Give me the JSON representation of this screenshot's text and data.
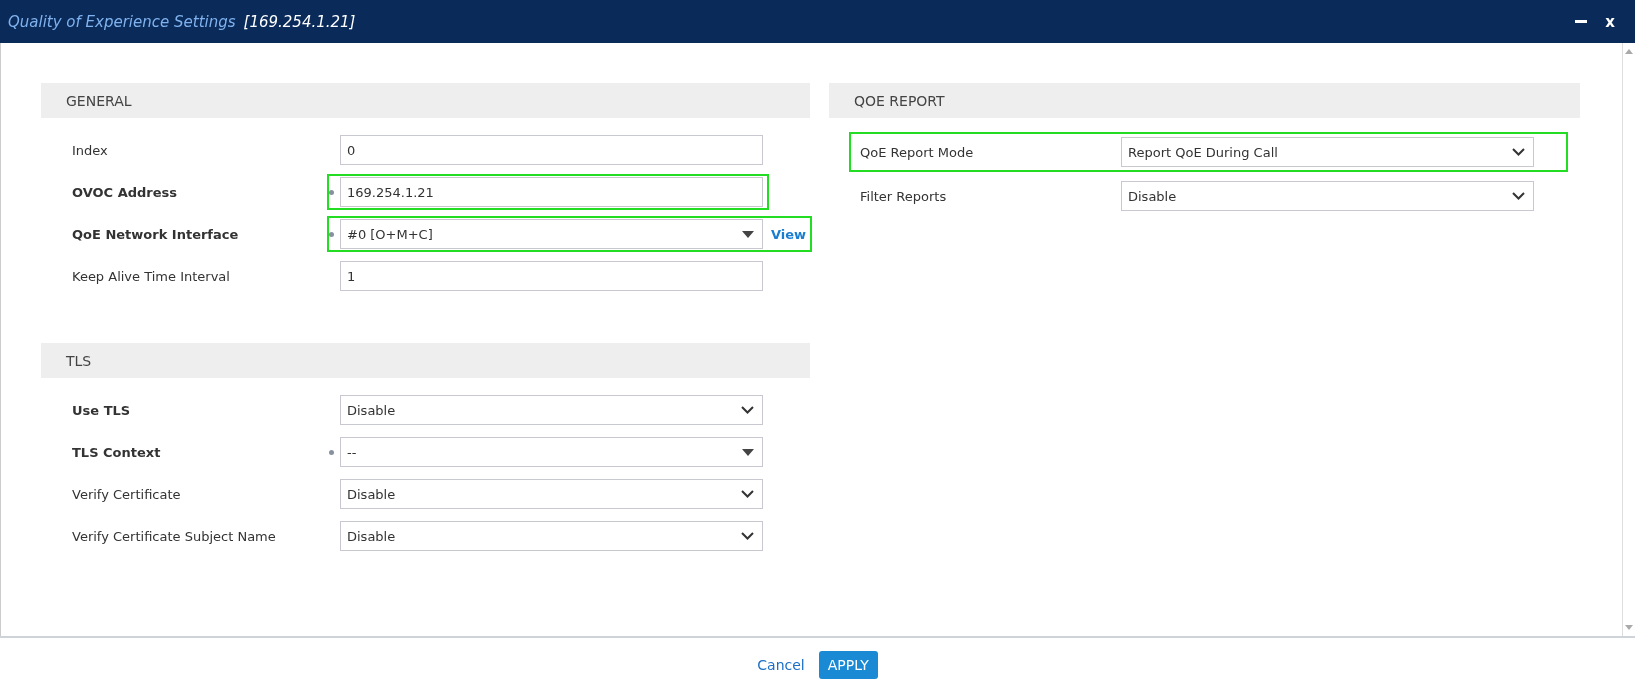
{
  "window": {
    "title": "Quality of Experience Settings",
    "subtitle": "[169.254.1.21]",
    "close_label": "x"
  },
  "left_sections": [
    {
      "title": "GENERAL",
      "fields": [
        {
          "label": "Index",
          "kind": "text",
          "value": "0",
          "mandatory": false,
          "modified": false,
          "highlighted": false
        },
        {
          "label": "OVOC Address",
          "kind": "text",
          "value": "169.254.1.21",
          "mandatory": true,
          "modified": true,
          "highlighted": true
        },
        {
          "label": "QoE Network Interface",
          "kind": "dropdown",
          "value": "#0 [O+M+C]",
          "mandatory": true,
          "modified": true,
          "highlighted": true,
          "link": "View"
        },
        {
          "label": "Keep Alive Time Interval",
          "kind": "text",
          "value": "1",
          "mandatory": false,
          "modified": false,
          "highlighted": false
        }
      ]
    },
    {
      "title": "TLS",
      "fields": [
        {
          "label": "Use TLS",
          "kind": "select",
          "value": "Disable",
          "mandatory": true,
          "modified": false,
          "highlighted": false
        },
        {
          "label": "TLS Context",
          "kind": "dropdown",
          "value": "--",
          "mandatory": true,
          "modified": true,
          "highlighted": false
        },
        {
          "label": "Verify Certificate",
          "kind": "select",
          "value": "Disable",
          "mandatory": false,
          "modified": false,
          "highlighted": false
        },
        {
          "label": "Verify Certificate Subject Name",
          "kind": "select",
          "value": "Disable",
          "mandatory": false,
          "modified": false,
          "highlighted": false
        }
      ]
    }
  ],
  "right_sections": [
    {
      "title": "QOE REPORT",
      "fields": [
        {
          "label": "QoE Report Mode",
          "kind": "select",
          "value": "Report QoE During Call",
          "mandatory": false,
          "modified": false,
          "highlighted": true
        },
        {
          "label": "Filter Reports",
          "kind": "select",
          "value": "Disable",
          "mandatory": false,
          "modified": false,
          "highlighted": false
        }
      ]
    }
  ],
  "footer": {
    "cancel": "Cancel",
    "apply": "APPLY"
  }
}
